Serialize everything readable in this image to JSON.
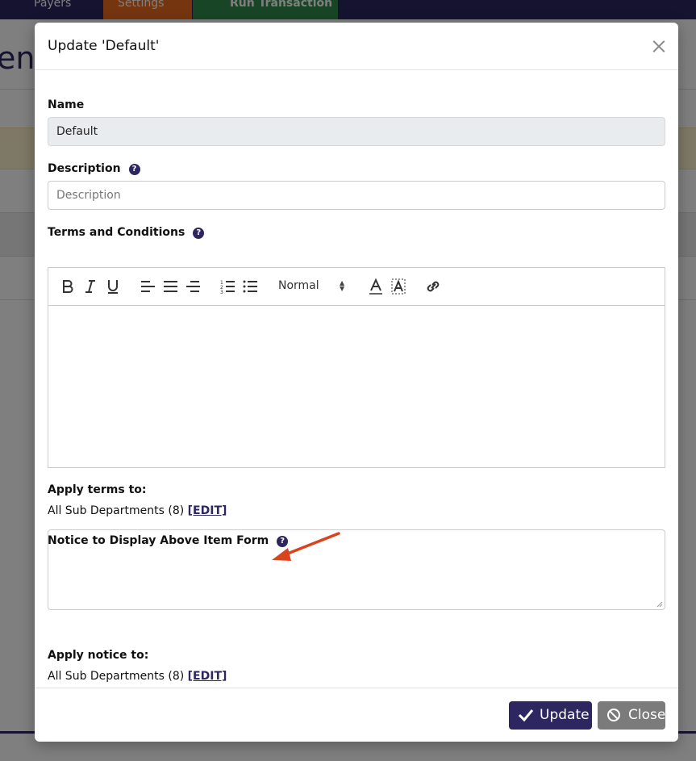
{
  "nav": {
    "payers_label": "Payers",
    "settings_label": "Settings",
    "run_transaction_label": "Run Transaction",
    "page_title_fragment": "ent"
  },
  "modal": {
    "title": "Update 'Default'",
    "name_label": "Name",
    "name_value": "Default",
    "description_label": "Description",
    "description_placeholder": "Description",
    "terms_label": "Terms and Conditions",
    "editor_format_value": "Normal",
    "apply_terms_label": "Apply terms to:",
    "apply_terms_value": "All Sub Departments (8)",
    "apply_terms_edit": "[EDIT]",
    "notice_label": "Notice to Display Above Item Form",
    "apply_notice_label": "Apply notice to:",
    "apply_notice_value": "All Sub Departments (8)",
    "apply_notice_edit": "[EDIT]",
    "help_icon_glyph": "?"
  },
  "footer": {
    "update_label": "Update",
    "close_label": "Close"
  },
  "colors": {
    "primary": "#2d2660",
    "settings_tab": "#e86a1f",
    "run_tab": "#2e8b4a",
    "close_button": "#7b7b7b",
    "annotation_arrow": "#d9431e"
  }
}
